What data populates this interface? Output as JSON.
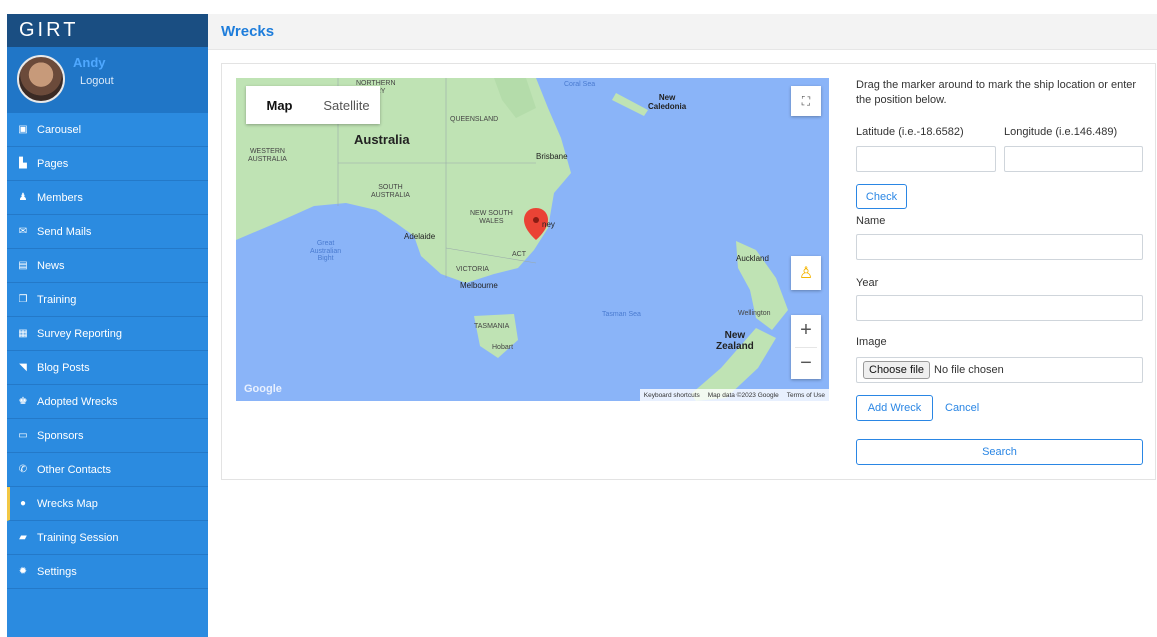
{
  "brand": "GIRT",
  "user": {
    "name": "Andy",
    "logout": "Logout"
  },
  "nav": [
    {
      "label": "Carousel",
      "icon": "image-icon"
    },
    {
      "label": "Pages",
      "icon": "file-icon"
    },
    {
      "label": "Members",
      "icon": "user-icon"
    },
    {
      "label": "Send Mails",
      "icon": "envelope-icon"
    },
    {
      "label": "News",
      "icon": "newspaper-icon"
    },
    {
      "label": "Training",
      "icon": "copy-icon"
    },
    {
      "label": "Survey Reporting",
      "icon": "list-icon"
    },
    {
      "label": "Blog Posts",
      "icon": "rss-icon"
    },
    {
      "label": "Adopted Wrecks",
      "icon": "user-check-icon"
    },
    {
      "label": "Sponsors",
      "icon": "badge-icon"
    },
    {
      "label": "Other Contacts",
      "icon": "phone-icon"
    },
    {
      "label": "Wrecks Map",
      "icon": "map-marker-icon",
      "active": true
    },
    {
      "label": "Training Session",
      "icon": "book-icon"
    },
    {
      "label": "Settings",
      "icon": "gear-icon"
    }
  ],
  "header": {
    "title": "Wrecks"
  },
  "map": {
    "type_map": "Map",
    "type_satellite": "Satellite",
    "labels": {
      "northern_territory": "NORTHERN\nTORY",
      "coral_sea": "Coral Sea",
      "new_caledonia": "New\nCaledonia",
      "queensland": "QUEENSLAND",
      "australia": "Australia",
      "western_australia": "WESTERN\nAUSTRALIA",
      "brisbane": "Brisbane",
      "south_australia": "SOUTH\nAUSTRALIA",
      "nsw": "NEW SOUTH\nWALES",
      "sydney": "ney",
      "adelaide": "Adelaide",
      "great_australian_bight": "Great\nAustralian\nBight",
      "act": "ACT",
      "victoria": "VICTORIA",
      "melbourne": "Melbourne",
      "auckland": "Auckland",
      "tasman_sea": "Tasman Sea",
      "wellington": "Wellington",
      "tasmania": "TASMANIA",
      "hobart": "Hobart",
      "new_zealand": "New\nZealand"
    },
    "footer_shortcuts": "Keyboard shortcuts",
    "footer_data": "Map data ©2023 Google",
    "footer_terms": "Terms of Use",
    "google": "Google"
  },
  "form": {
    "help": "Drag the marker around to mark the ship location or enter the position below.",
    "latitude_label": "Latitude (i.e.-18.6582)",
    "longitude_label": "Longitude (i.e.146.489)",
    "check": "Check",
    "name_label": "Name",
    "year_label": "Year",
    "image_label": "Image",
    "choose_file": "Choose file",
    "no_file": "No file chosen",
    "add_wreck": "Add Wreck",
    "cancel": "Cancel",
    "search": "Search"
  },
  "colors": {
    "sidebar": "#2b8be0",
    "brand_bg": "#1a4e82",
    "accent": "#2a86e4",
    "active_marker": "#f2c744",
    "water": "#8ab4f8",
    "land": "#bfe3b4"
  }
}
